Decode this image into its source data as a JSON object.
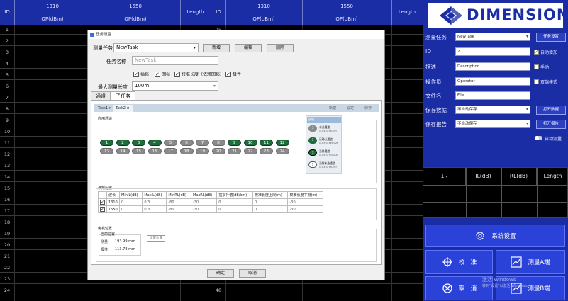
{
  "grid_left": {
    "headers": {
      "id": "ID",
      "wl1": "1310",
      "wl1_sub": "OP(dBm)",
      "wl2": "1550",
      "wl2_sub": "OP(dBm)",
      "length": "Length"
    },
    "rows": [
      "1",
      "2",
      "3",
      "4",
      "5",
      "6",
      "7",
      "8",
      "9",
      "10",
      "11",
      "12",
      "13",
      "14",
      "15",
      "16",
      "17",
      "18",
      "19",
      "20",
      "21",
      "22",
      "23",
      "24"
    ]
  },
  "grid_right": {
    "headers": {
      "id": "ID",
      "wl1": "1310",
      "wl1_sub": "OP(dBm)",
      "wl2": "1550",
      "wl2_sub": "OP(dBm)",
      "length": "Length"
    },
    "rows": [
      "25",
      "",
      "",
      "",
      "",
      "",
      "",
      "",
      "",
      "",
      "",
      "",
      "",
      "",
      "",
      "",
      "",
      "",
      "",
      "",
      "",
      "",
      "47",
      "48"
    ]
  },
  "panel": {
    "logo_text": "DIMENSION",
    "task_label": "测量任务",
    "task_value": "NewTask",
    "task_btn": "任务设置",
    "id_label": "ID",
    "id_value": "7",
    "auto_inc": "自动增加",
    "desc_label": "描述",
    "desc_value": "Description",
    "desc_check": "手动",
    "operator_label": "操作员",
    "operator_value": "Operator",
    "dual_check": "双端模式",
    "file_label": "文件名",
    "file_value": "File",
    "save_data_label": "保存数据",
    "save_data_value": "不自动保存",
    "open_data_btn": "打开数据",
    "save_report_label": "保存报告",
    "save_report_value": "不自动保存",
    "open_report_btn": "打开报告",
    "auto_measure": "自动测量",
    "result_headers": [
      "1",
      "IL(dB)",
      "RL(dB)",
      "Length"
    ],
    "system_settings": "系统设置",
    "calibrate": "校　准",
    "measure_a": "测量A端",
    "cancel": "取　消",
    "measure_b": "测量B端"
  },
  "watermark": {
    "line1": "激活 Windows",
    "line2": "转到\"设置\"以激活 Windows。"
  },
  "dialog": {
    "title": "任务设置",
    "task_label": "测量任务",
    "task_value": "NewTask",
    "btn_new": "新增",
    "btn_edit": "编辑",
    "btn_delete": "删除",
    "name_label": "任务名称",
    "name_placeholder": "NewTask",
    "checks": [
      "插损",
      "回损",
      "校准长度（依赖回损）",
      "极性"
    ],
    "maxlen_label": "最大测量长度",
    "maxlen_value": "100m",
    "tabs": [
      "通道",
      "子任务"
    ],
    "subtabs": [
      "Task1 ×",
      "Task2 ×"
    ],
    "sub_actions": [
      "新建",
      "设定",
      "保存"
    ],
    "channels_title": "应用通道",
    "channels_on": [
      "1",
      "2",
      "3",
      "4",
      "9",
      "10",
      "11",
      "12"
    ],
    "channels_off": [
      "5",
      "6",
      "7",
      "8",
      "13",
      "14",
      "15",
      "16",
      "17",
      "18",
      "19",
      "20",
      "21",
      "22",
      "23",
      "24"
    ],
    "legend_title": "说明",
    "legend_items": [
      {
        "pill": "1",
        "title": "未选通道",
        "sub": "CLICK to SELECT"
      },
      {
        "pill": "1",
        "title": "已确认通道",
        "sub": "CLICK to REMOVE"
      },
      {
        "pill": "1",
        "title": "当前通道",
        "sub": "CLICK to TOGGLE"
      },
      {
        "pill": "1",
        "title": "当前未选通道",
        "sub": "CLICK to SELECT"
      }
    ],
    "params_title": "参数配置",
    "param_headers": [
      "",
      "波长",
      "MinIL(dB)",
      "MaxIL(dB)",
      "MinRL(dB)",
      "MaxRL(dB)",
      "插损补偿(dB/km)",
      "校准长度上限(m)",
      "校准长度下限(m)"
    ],
    "param_rows": [
      [
        "1310",
        "0",
        "0.3",
        "-80",
        "-30",
        "0",
        "0",
        "-30"
      ],
      [
        "1550",
        "0",
        "0.3",
        "-80",
        "-30",
        "0",
        "0",
        "-30"
      ]
    ],
    "motor_title": "电机位置",
    "motor_sub": "当前位置",
    "motor_measure_label": "测量:",
    "motor_measure_value": "193.99 mm",
    "motor_pol_label": "极性:",
    "motor_pol_value": "113.78 mm",
    "motor_btn": "设置位置",
    "ok": "确定",
    "cancel": "取消"
  }
}
